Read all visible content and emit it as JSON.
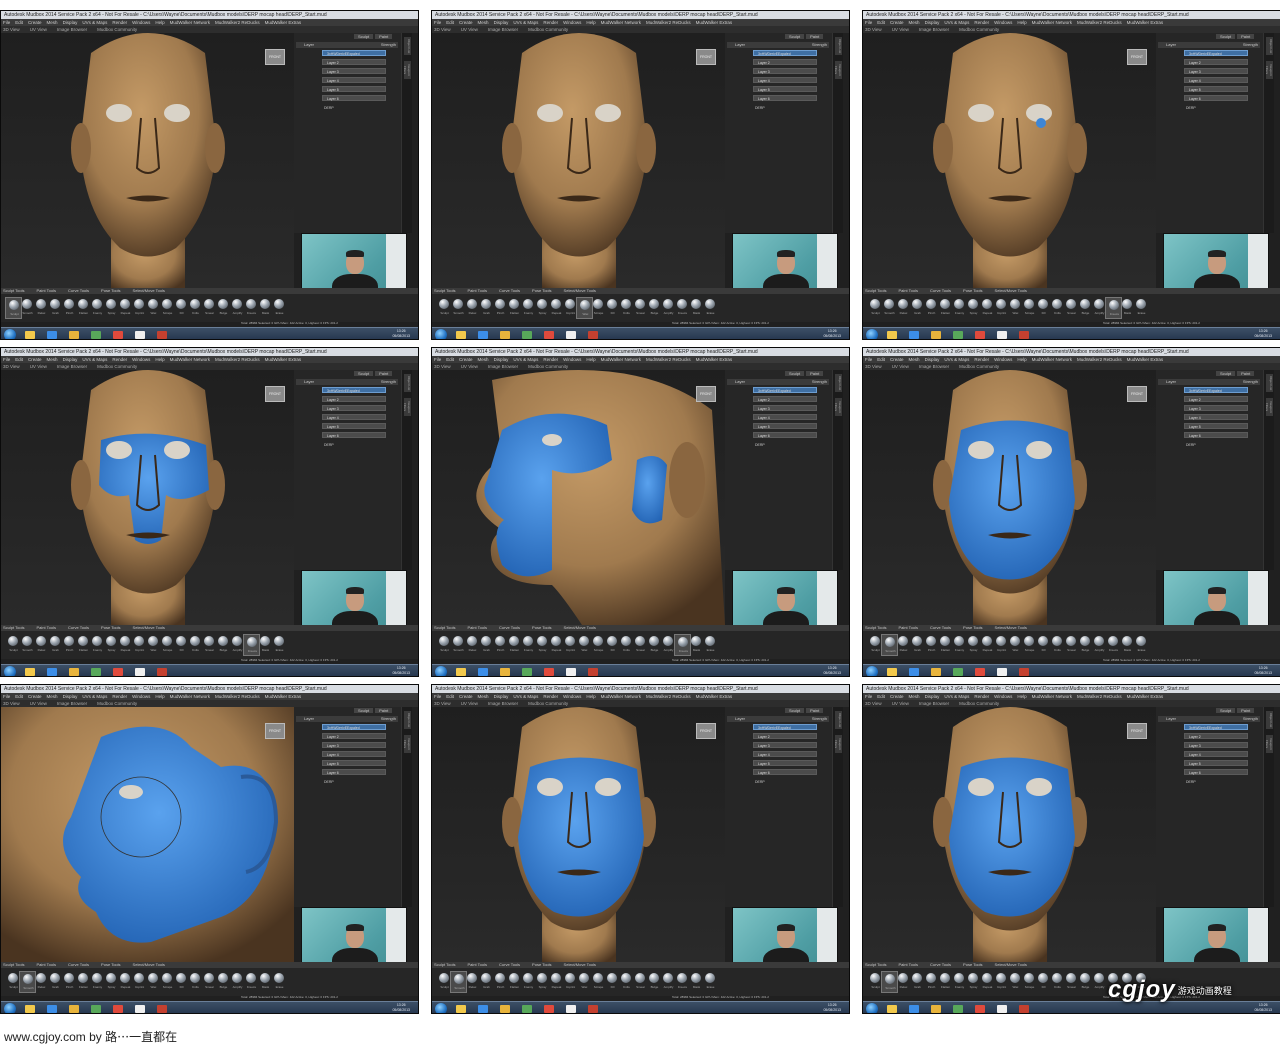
{
  "window": {
    "title": "Autodesk Mudbox 2014 Service Pack 2 x64 - Not For Resale - C:\\Users\\Wayne\\Documents\\Mudbox models\\DERP mocap head\\DERP_Start.mud",
    "menu": [
      "File",
      "Edit",
      "Create",
      "Mesh",
      "Display",
      "UVs & Maps",
      "Render",
      "Windows",
      "Help",
      "MudWalker Network",
      "MudWalker2 ReDucks",
      "MudWalker Extras"
    ],
    "view_tabs": [
      "3D View",
      "UV View",
      "Image Browser",
      "Mudbox Community"
    ],
    "view_cube_label": "FRONT"
  },
  "layers_panel": {
    "mode_buttons": [
      "Sculpt",
      "Paint"
    ],
    "header": "Layer",
    "strength_header": "Strength",
    "selected_layer": "3xHWDerivEExpaled",
    "layers": [
      "3xHWDerivEExpaled",
      "Layer 2",
      "Layer 3",
      "Layer 4",
      "Layer 5",
      "Layer 6"
    ],
    "root_object": "DERP",
    "side_tabs": [
      "Object List",
      "Viewport Filters"
    ]
  },
  "tool_tray": {
    "tabs": [
      "Sculpt Tools",
      "Paint Tools",
      "Curve Tools",
      "Pose Tools",
      "Select/Move Tools"
    ],
    "tools": [
      "Sculpt",
      "Smooth",
      "Relax",
      "Grab",
      "Pinch",
      "Flatten",
      "Foamy",
      "Spray",
      "Repeat",
      "Imprint",
      "Wax",
      "Scrape",
      "Fill",
      "Knife",
      "Smear",
      "Bulge",
      "Amplify",
      "Freeze",
      "Mask",
      "Erase"
    ]
  },
  "status_text": "Total: 28984  Selected: 0  GPU Mem: 422  Active: 0, Highest: 0  FPS: 201.2",
  "taskbar": {
    "time": "13:26",
    "date": "05/08/2013"
  },
  "frames": [
    {
      "view": "front",
      "mask": "none",
      "active_tool": "Sculpt"
    },
    {
      "view": "front",
      "mask": "none",
      "active_tool": "Wax"
    },
    {
      "view": "front",
      "mask": "dot",
      "active_tool": "Freeze"
    },
    {
      "view": "front",
      "mask": "upper",
      "active_tool": "Freeze"
    },
    {
      "view": "side",
      "mask": "side-partial",
      "active_tool": "Freeze"
    },
    {
      "view": "front",
      "mask": "full",
      "active_tool": "Smooth"
    },
    {
      "view": "closeup",
      "mask": "closeup",
      "active_tool": "Smooth"
    },
    {
      "view": "front",
      "mask": "full",
      "active_tool": "Smooth"
    },
    {
      "view": "front",
      "mask": "full",
      "active_tool": "Smooth"
    }
  ],
  "caption": "www.cgjoy.com by 路⋯一直都在",
  "watermark": {
    "logo_text": "cgjoy",
    "tagline": "游戏动画教程"
  },
  "colors": {
    "skin": "#a07a4e",
    "mask": "#3d86d6",
    "ui_dark": "#262626",
    "taskbar": "#22324a"
  }
}
